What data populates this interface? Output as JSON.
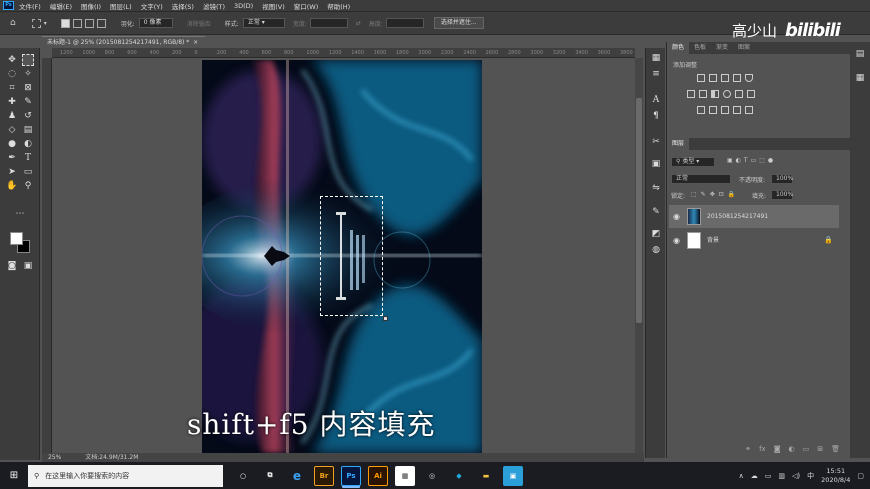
{
  "app": {
    "logo": "Ps"
  },
  "menu": [
    "文件(F)",
    "编辑(E)",
    "图像(I)",
    "图层(L)",
    "文字(Y)",
    "选择(S)",
    "滤镜(T)",
    "3D(D)",
    "视图(V)",
    "窗口(W)",
    "帮助(H)"
  ],
  "options": {
    "feather_label": "羽化:",
    "feather_value": "0 像素",
    "antialias_label": "消除锯齿",
    "style_label": "样式:",
    "style_value": "正常",
    "width_label": "宽度:",
    "height_label": "高度:",
    "select_mask_button": "选择并遮住..."
  },
  "watermark": {
    "author": "高少山",
    "brand": "bilibili"
  },
  "document": {
    "tab_title": "未标题-1 @ 25% (2015081254217491, RGB/8) *",
    "zoom": "25%",
    "doc_size": "文档:24.9M/31.2M"
  },
  "ruler": {
    "h_ticks": [
      "1200",
      "1000",
      "800",
      "600",
      "400",
      "200",
      "0",
      "200",
      "400",
      "600",
      "800",
      "1000",
      "1200",
      "1400",
      "1600",
      "1800",
      "2000",
      "2200",
      "2400",
      "2600",
      "2800",
      "3000",
      "3200",
      "3400",
      "3600",
      "3800"
    ]
  },
  "caption": "shift+f5  内容填充",
  "panels": {
    "top_tabs": [
      "颜色",
      "色板",
      "渐变",
      "图案"
    ],
    "adjust_title": "添加调整",
    "layers_tab": "图层",
    "kind_label": "类型",
    "blend_mode": "正常",
    "opacity_label": "不透明度:",
    "opacity_value": "100%",
    "lock_label": "锁定:",
    "fill_label": "填充:",
    "fill_value": "100%",
    "layers": [
      {
        "name": "2015081254217491"
      },
      {
        "name": "背景"
      }
    ]
  },
  "taskbar": {
    "search_placeholder": "在这里输入你要搜索的内容",
    "apps": [
      "Ps",
      "Ai"
    ],
    "ime": "中",
    "time": "15:51",
    "date": "2020/8/4"
  },
  "colors": {
    "ps_blue": "#31a8ff",
    "panel": "#535353",
    "chrome": "#3c3c3c"
  }
}
